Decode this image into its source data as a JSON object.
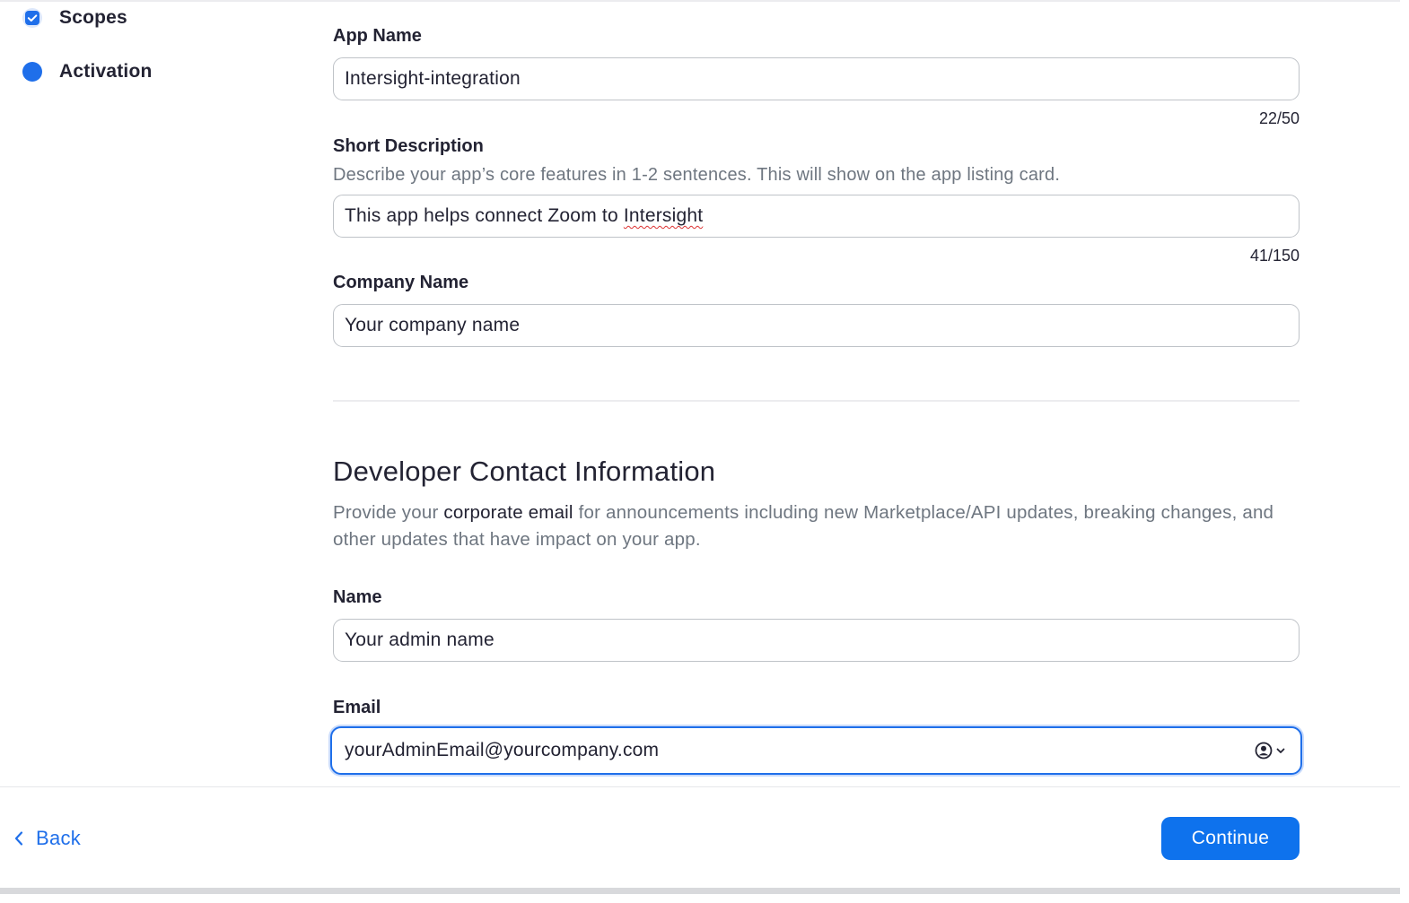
{
  "sidebar": {
    "steps": [
      {
        "label": "Scopes",
        "state": "completed"
      },
      {
        "label": "Activation",
        "state": "current"
      }
    ]
  },
  "form": {
    "app_name": {
      "label": "App Name",
      "value": "Intersight-integration",
      "counter": "22/50"
    },
    "short_description": {
      "label": "Short Description",
      "help": "Describe your app’s core features in 1-2 sentences. This will show on the app listing card.",
      "value_prefix": "This app helps connect Zoom to ",
      "value_flagged_word": "Intersight",
      "counter": "41/150"
    },
    "company_name": {
      "label": "Company Name",
      "value": "Your company name"
    }
  },
  "developer_contact": {
    "title": "Developer Contact Information",
    "desc_before": "Provide your ",
    "desc_emphasis": "corporate email",
    "desc_after": " for announcements including new Marketplace/API updates, breaking changes, and other updates that have impact on your app.",
    "name": {
      "label": "Name",
      "value": "Your admin name"
    },
    "email": {
      "label": "Email",
      "value": "yourAdminEmail@yourcompany.com"
    }
  },
  "footer": {
    "back_label": "Back",
    "continue_label": "Continue"
  },
  "colors": {
    "accent": "#1f6fea",
    "button": "#0e72ed",
    "text": "#232333",
    "muted": "#6e7680"
  }
}
